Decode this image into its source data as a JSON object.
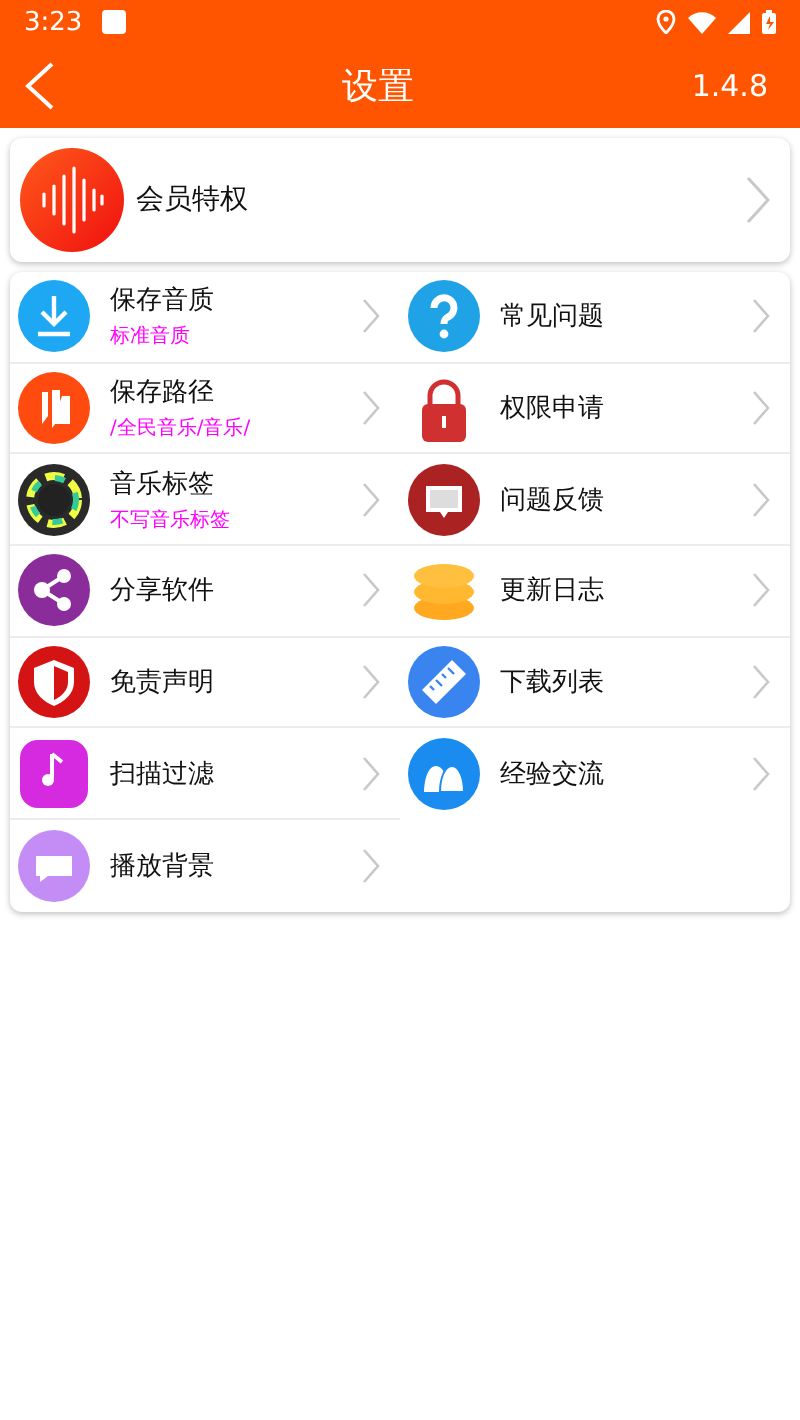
{
  "status_bar": {
    "time": "3:23"
  },
  "header": {
    "title": "设置",
    "version": "1.4.8"
  },
  "vip": {
    "label": "会员特权"
  },
  "columns": [
    [
      {
        "title": "保存音质",
        "subtitle": "标准音质"
      },
      {
        "title": "保存路径",
        "subtitle": "/全民音乐/音乐/"
      },
      {
        "title": "音乐标签",
        "subtitle": "不写音乐标签"
      },
      {
        "title": "分享软件"
      },
      {
        "title": "免责声明"
      },
      {
        "title": "扫描过滤"
      },
      {
        "title": "播放背景"
      }
    ],
    [
      {
        "title": "常见问题"
      },
      {
        "title": "权限申请"
      },
      {
        "title": "问题反馈"
      },
      {
        "title": "更新日志"
      },
      {
        "title": "下载列表"
      },
      {
        "title": "经验交流"
      }
    ]
  ]
}
